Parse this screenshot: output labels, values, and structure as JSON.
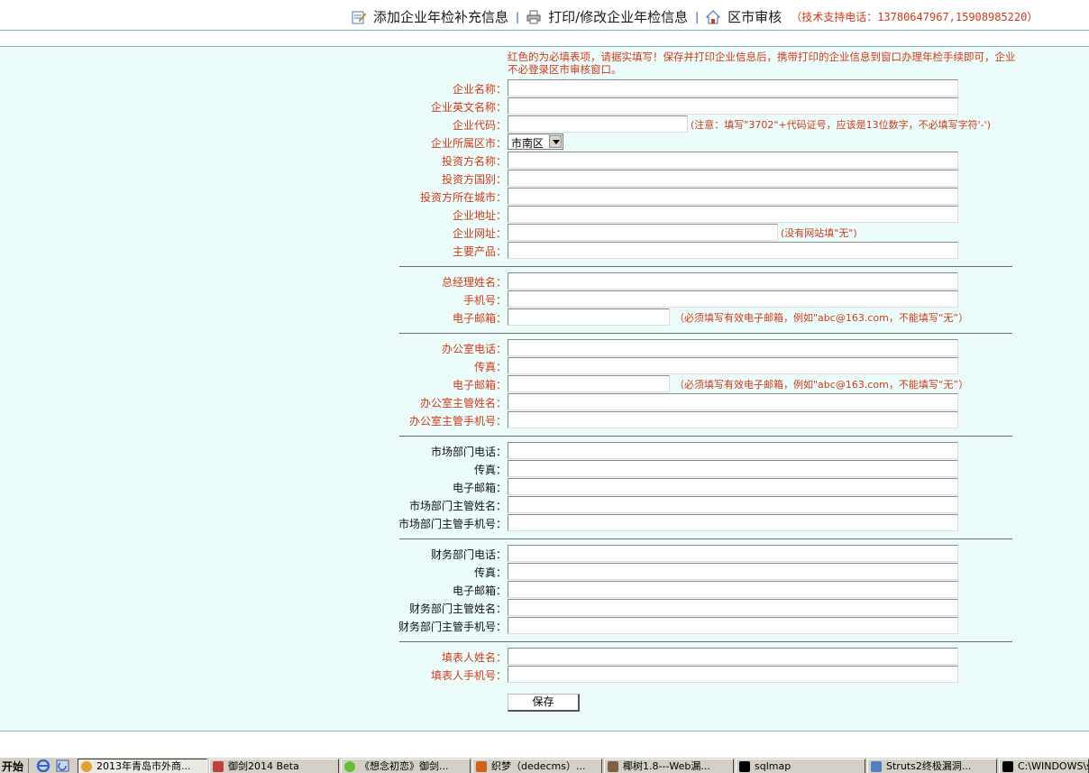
{
  "header": {
    "nav": [
      {
        "label": "添加企业年检补充信息",
        "icon": "edit-document-icon"
      },
      {
        "label": "打印/修改企业年检信息",
        "icon": "printer-icon"
      },
      {
        "label": "区市审核",
        "icon": "home-icon"
      }
    ],
    "separator": "|",
    "support": "（技术支持电话：13780647967,15908985220）"
  },
  "notice": "红色的为必填表项，请据实填写！保存并打印企业信息后，携带打印的企业信息到窗口办理年检手续即可，企业不必登录区市审核窗口。",
  "colors": {
    "required": "#d23a1a",
    "background": "#ecfcfb",
    "link_separator": "#1a55b4"
  },
  "form": {
    "company": {
      "name": "企业名称：",
      "english_name": "企业英文名称：",
      "code": "企业代码：",
      "code_hint": "(注意：填写\"3702\"+代码证号，应该是13位数字，不必填写字符'-')",
      "district": "企业所属区市：",
      "district_value": "市南区",
      "investor_name": "投资方名称：",
      "investor_country": "投资方国别：",
      "investor_city": "投资方所在城市：",
      "address": "企业地址：",
      "website": "企业网址：",
      "website_hint": "(没有网站填\"无\")",
      "products": "主要产品："
    },
    "manager": {
      "name": "总经理姓名：",
      "mobile": "手机号：",
      "email": "电子邮箱：",
      "email_hint": "（必须填写有效电子邮箱，例如\"abc@163.com，不能填写“无”）"
    },
    "office": {
      "phone": "办公室电话：",
      "fax": "传真：",
      "email": "电子邮箱：",
      "email_hint": "（必须填写有效电子邮箱，例如\"abc@163.com，不能填写“无”）",
      "head_name": "办公室主管姓名：",
      "head_mobile": "办公室主管手机号："
    },
    "market": {
      "phone": "市场部门电话：",
      "fax": "传真：",
      "email": "电子邮箱：",
      "head_name": "市场部门主管姓名：",
      "head_mobile": "市场部门主管手机号："
    },
    "finance": {
      "phone": "财务部门电话：",
      "fax": "传真：",
      "email": "电子邮箱：",
      "head_name": "财务部门主管姓名：",
      "head_mobile": "财务部门主管手机号："
    },
    "filler": {
      "name": "填表人姓名：",
      "mobile": "填表人手机号："
    },
    "save_label": "保存"
  },
  "taskbar": {
    "start": "开始",
    "tasks": [
      "2013年青岛市外商...",
      "御剑2014 Beta",
      "《想念初恋》御剑...",
      "织梦（dedecms）...",
      "椰树1.8---Web漏...",
      "sqlmap",
      "Struts2终极漏洞...",
      "C:\\WINDOWS\\s"
    ]
  }
}
